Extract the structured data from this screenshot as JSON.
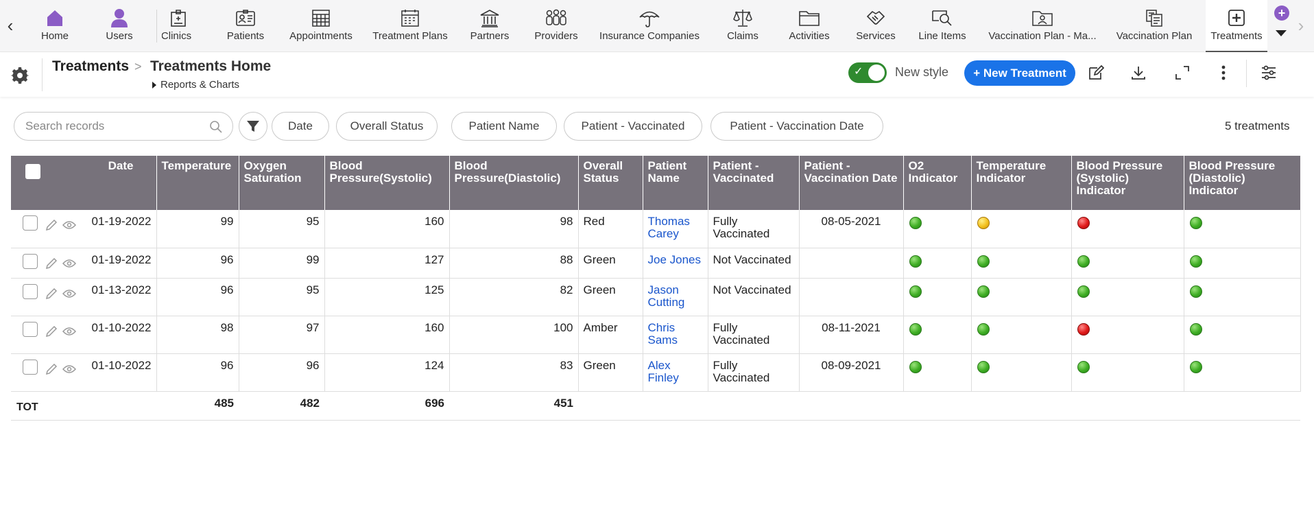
{
  "nav": {
    "items": [
      {
        "label": "Home",
        "icon": "home-icon"
      },
      {
        "label": "Users",
        "icon": "user-icon"
      },
      {
        "label": "Clinics",
        "icon": "clinic-icon"
      },
      {
        "label": "Patients",
        "icon": "id-card-icon"
      },
      {
        "label": "Appointments",
        "icon": "calendar-grid-icon"
      },
      {
        "label": "Treatment Plans",
        "icon": "calendar-icon"
      },
      {
        "label": "Partners",
        "icon": "bank-icon"
      },
      {
        "label": "Providers",
        "icon": "people-icon"
      },
      {
        "label": "Insurance Companies",
        "icon": "umbrella-icon"
      },
      {
        "label": "Claims",
        "icon": "scales-icon"
      },
      {
        "label": "Activities",
        "icon": "folder-icon"
      },
      {
        "label": "Services",
        "icon": "handshake-icon"
      },
      {
        "label": "Line Items",
        "icon": "search-doc-icon"
      },
      {
        "label": "Vaccination Plan - Ma...",
        "icon": "folder-person-icon"
      },
      {
        "label": "Vaccination Plan",
        "icon": "documents-icon"
      },
      {
        "label": "Treatments",
        "icon": "plus-box-icon",
        "active": true
      }
    ],
    "accent_color": "#8b5cc5"
  },
  "header": {
    "breadcrumb_root": "Treatments",
    "breadcrumb_separator": ">",
    "page_title": "Treatments Home",
    "reports_label": "Reports & Charts",
    "toggle_label": "New style",
    "toggle_on": true,
    "new_button_label": "+ New Treatment",
    "brand_color": "#1a73e8"
  },
  "filters": {
    "search_placeholder": "Search records",
    "chips": [
      "Date",
      "Overall Status",
      "Patient Name",
      "Patient - Vaccinated",
      "Patient - Vaccination Date"
    ],
    "record_count": "5 treatments"
  },
  "table": {
    "columns": [
      "Date",
      "Temperature",
      "Oxygen Saturation",
      "Blood Pressure(Systolic)",
      "Blood Pressure(Diastolic)",
      "Overall Status",
      "Patient Name",
      "Patient - Vaccinated",
      "Patient - Vaccination Date",
      "O2 Indicator",
      "Temperature Indicator",
      "Blood Pressure (Systolic) Indicator",
      "Blood Pressure (Diastolic) Indicator"
    ],
    "rows": [
      {
        "date": "01-19-2022",
        "temperature": "99",
        "oxygen": "95",
        "systolic": "160",
        "diastolic": "98",
        "status": "Red",
        "patient": "Thomas Carey",
        "vaccinated": "Fully Vaccinated",
        "vacc_date": "08-05-2021",
        "o2": "green",
        "temp_ind": "amber",
        "sys_ind": "red",
        "dia_ind": "green"
      },
      {
        "date": "01-19-2022",
        "temperature": "96",
        "oxygen": "99",
        "systolic": "127",
        "diastolic": "88",
        "status": "Green",
        "patient": "Joe Jones",
        "vaccinated": "Not Vaccinated",
        "vacc_date": "",
        "o2": "green",
        "temp_ind": "green",
        "sys_ind": "green",
        "dia_ind": "green"
      },
      {
        "date": "01-13-2022",
        "temperature": "96",
        "oxygen": "95",
        "systolic": "125",
        "diastolic": "82",
        "status": "Green",
        "patient": "Jason Cutting",
        "vaccinated": "Not Vaccinated",
        "vacc_date": "",
        "o2": "green",
        "temp_ind": "green",
        "sys_ind": "green",
        "dia_ind": "green"
      },
      {
        "date": "01-10-2022",
        "temperature": "98",
        "oxygen": "97",
        "systolic": "160",
        "diastolic": "100",
        "status": "Amber",
        "patient": "Chris Sams",
        "vaccinated": "Fully Vaccinated",
        "vacc_date": "08-11-2021",
        "o2": "green",
        "temp_ind": "green",
        "sys_ind": "red",
        "dia_ind": "green"
      },
      {
        "date": "01-10-2022",
        "temperature": "96",
        "oxygen": "96",
        "systolic": "124",
        "diastolic": "83",
        "status": "Green",
        "patient": "Alex Finley",
        "vaccinated": "Fully Vaccinated",
        "vacc_date": "08-09-2021",
        "o2": "green",
        "temp_ind": "green",
        "sys_ind": "green",
        "dia_ind": "green"
      }
    ],
    "totals": {
      "label": "TOT",
      "temperature": "485",
      "oxygen": "482",
      "systolic": "696",
      "diastolic": "451"
    },
    "header_color": "#77727b",
    "link_color": "#1a56cc"
  }
}
